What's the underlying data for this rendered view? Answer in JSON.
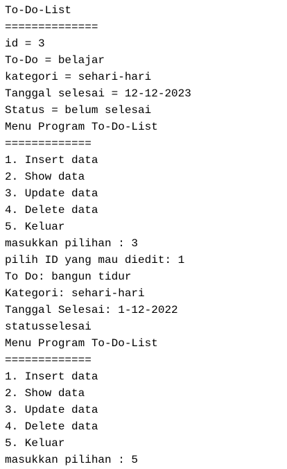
{
  "console": {
    "lines": [
      "To-Do-List",
      "==============",
      "id = 3",
      "To-Do = belajar",
      "kategori = sehari-hari",
      "Tanggal selesai = 12-12-2023",
      "Status = belum selesai",
      "Menu Program To-Do-List",
      "=============",
      "1. Insert data",
      "2. Show data",
      "3. Update data",
      "4. Delete data",
      "5. Keluar",
      "masukkan pilihan : 3",
      "pilih ID yang mau diedit: 1",
      "To Do: bangun tidur",
      "Kategori: sehari-hari",
      "Tanggal Selesai: 1-12-2022",
      "statusselesai",
      "Menu Program To-Do-List",
      "=============",
      "1. Insert data",
      "2. Show data",
      "3. Update data",
      "4. Delete data",
      "5. Keluar",
      "masukkan pilihan : 5"
    ]
  }
}
